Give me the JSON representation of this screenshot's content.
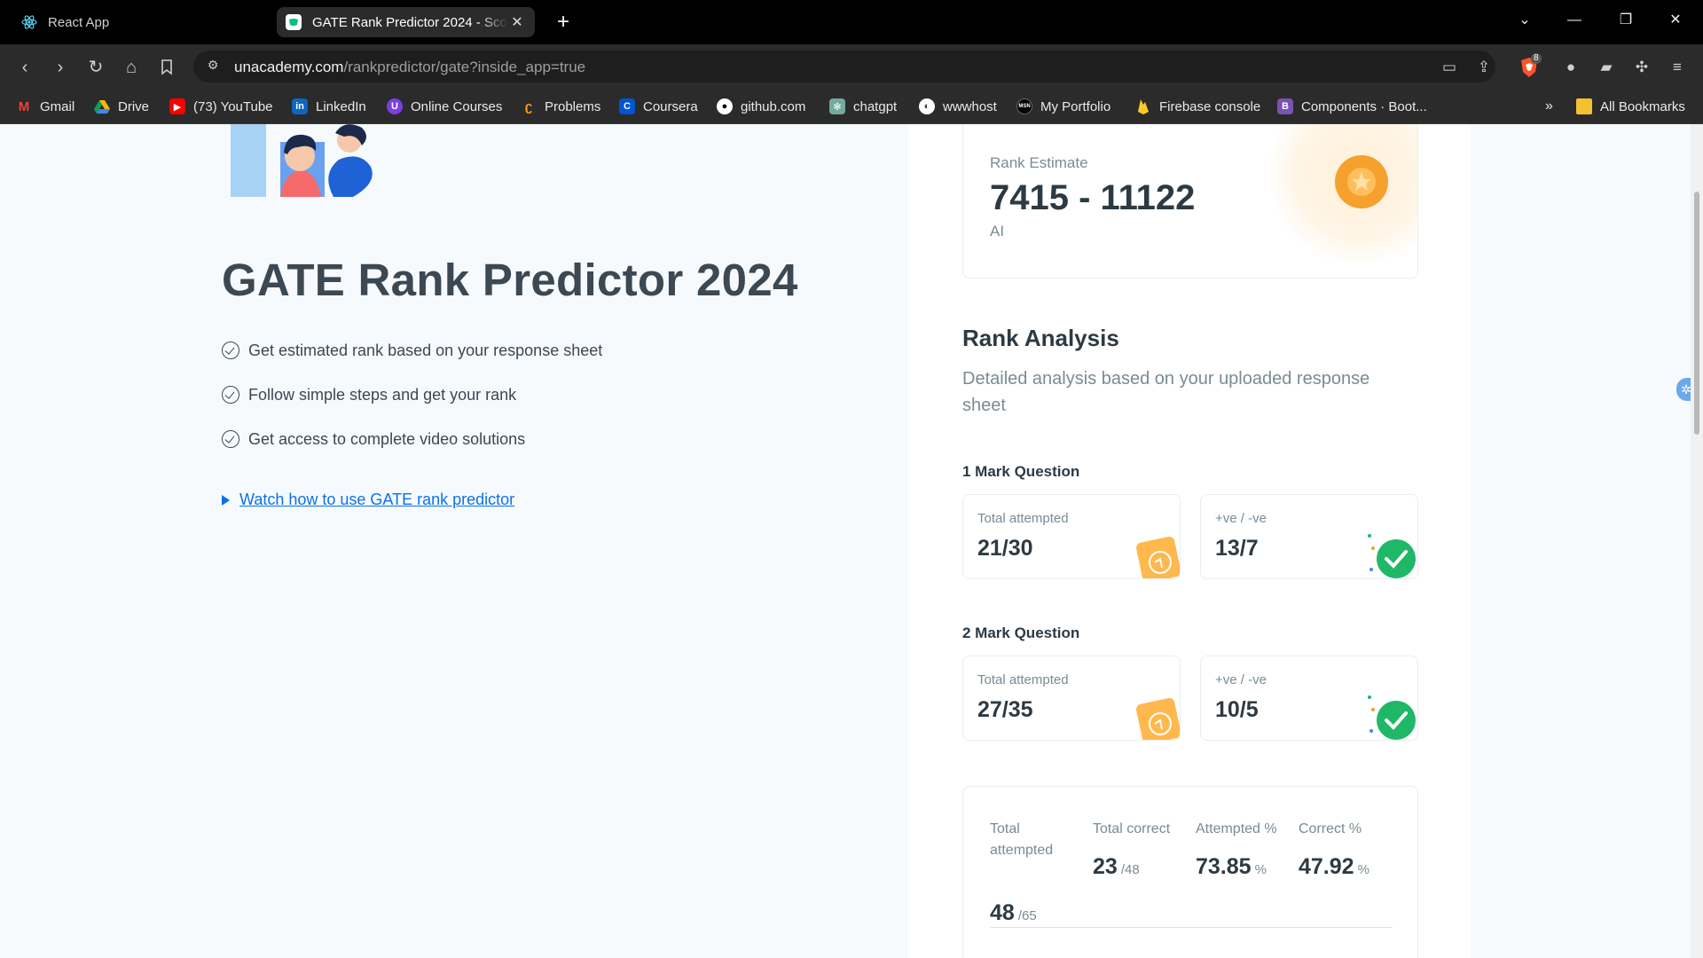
{
  "browser": {
    "tabs": [
      {
        "title": "React App",
        "icon": "react-icon",
        "active": false
      },
      {
        "title": "GATE Rank Predictor 2024 - Score",
        "icon": "unacademy-icon",
        "active": true
      }
    ],
    "url_host": "unacademy.com",
    "url_path": "/rankpredictor/gate?inside_app=true",
    "extension_badge": "8",
    "bookmarks": [
      {
        "label": "Gmail",
        "icon": "gmail-icon"
      },
      {
        "label": "Drive",
        "icon": "drive-icon"
      },
      {
        "label": "(73) YouTube",
        "icon": "youtube-icon"
      },
      {
        "label": "LinkedIn",
        "icon": "linkedin-icon"
      },
      {
        "label": "Online Courses",
        "icon": "courses-icon"
      },
      {
        "label": "Problems",
        "icon": "problems-icon"
      },
      {
        "label": "Coursera",
        "icon": "coursera-icon"
      },
      {
        "label": "github.com",
        "icon": "github-icon"
      },
      {
        "label": "chatgpt",
        "icon": "chatgpt-icon"
      },
      {
        "label": "wwwhost",
        "icon": "globe-icon"
      },
      {
        "label": "My Portfolio",
        "icon": "msn-icon"
      },
      {
        "label": "Firebase console",
        "icon": "firebase-icon"
      },
      {
        "label": "Components · Boot...",
        "icon": "bootstrap-icon"
      }
    ],
    "overflow_label": "»",
    "all_bookmarks_label": "All Bookmarks"
  },
  "hero": {
    "title": "GATE Rank Predictor 2024",
    "features": [
      "Get estimated rank based on your response sheet",
      "Follow simple steps and get your rank",
      "Get access to complete video solutions"
    ],
    "watch_link": "Watch how to use GATE rank predictor"
  },
  "rank": {
    "label": "Rank Estimate",
    "value": "7415 - 11122",
    "sub": "AI"
  },
  "analysis": {
    "title": "Rank Analysis",
    "description": "Detailed analysis based on your uploaded response sheet",
    "one_mark": {
      "title": "1 Mark Question",
      "attempted_label": "Total attempted",
      "attempted_value": "21/30",
      "pn_label": "+ve / -ve",
      "pn_value": "13/7"
    },
    "two_mark": {
      "title": "2 Mark Question",
      "attempted_label": "Total attempted",
      "attempted_value": "27/35",
      "pn_label": "+ve / -ve",
      "pn_value": "10/5"
    },
    "summary": {
      "total_attempted_label": "Total attempted",
      "total_attempted_value": "48",
      "total_attempted_of": "/65",
      "total_correct_label": "Total correct",
      "total_correct_value": "23",
      "total_correct_of": "/48",
      "attempted_pct_label": "Attempted %",
      "attempted_pct_value": "73.85",
      "attempted_pct_unit": "%",
      "correct_pct_label": "Correct %",
      "correct_pct_value": "47.92",
      "correct_pct_unit": "%"
    }
  },
  "colors": {
    "accent_blue": "#0b72e7",
    "text_dark": "#3c4852",
    "medal_orange": "#f6a12d",
    "check_green": "#1fb866"
  }
}
